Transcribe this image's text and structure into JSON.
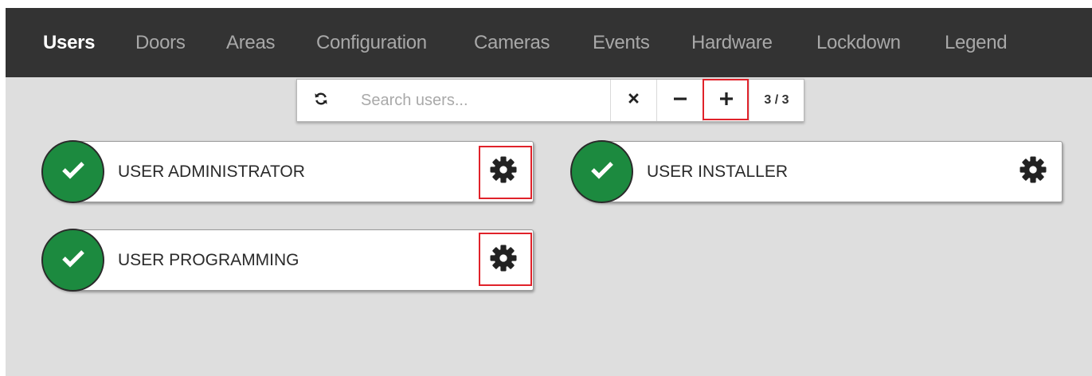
{
  "nav": {
    "items": [
      {
        "label": "Users",
        "active": true
      },
      {
        "label": "Doors"
      },
      {
        "label": "Areas"
      },
      {
        "label": "Configuration"
      },
      {
        "label": "Cameras"
      },
      {
        "label": "Events"
      },
      {
        "label": "Hardware"
      },
      {
        "label": "Lockdown"
      },
      {
        "label": "Legend"
      }
    ]
  },
  "toolbar": {
    "refresh_icon": "refresh-icon",
    "search_placeholder": "Search users...",
    "clear_icon": "close-icon",
    "minus_icon": "minus-icon",
    "plus_icon": "plus-icon",
    "counter": "3 / 3"
  },
  "users": [
    {
      "name": "USER ADMINISTRATOR",
      "status_icon": "check-icon",
      "settings_icon": "gear-icon"
    },
    {
      "name": "USER INSTALLER",
      "status_icon": "check-icon",
      "settings_icon": "gear-icon"
    },
    {
      "name": "USER PROGRAMMING",
      "status_icon": "check-icon",
      "settings_icon": "gear-icon"
    }
  ],
  "colors": {
    "navbar": "#333333",
    "active_nav": "#ffffff",
    "inactive_nav": "#a8a8a8",
    "status_ok": "#1c8a3f",
    "highlight": "#e0222a",
    "background": "#dedede"
  }
}
